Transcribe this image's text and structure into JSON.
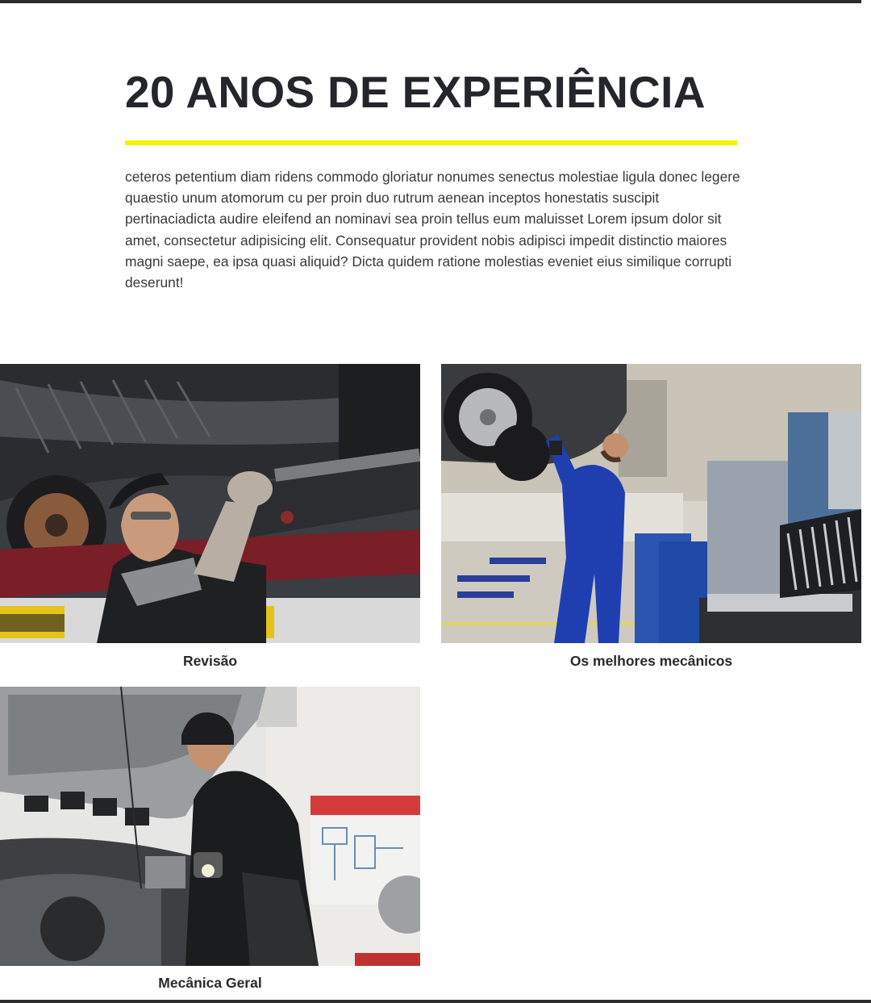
{
  "heading": "20 ANOS DE EXPERIÊNCIA",
  "paragraph": "ceteros petentium diam ridens commodo gloriatur nonumes senectus molestiae ligula donec legere quaestio unum atomorum cu per proin duo rutrum aenean inceptos honestatis suscipit pertinaciadicta audire eleifend an nominavi sea proin tellus eum maluisset Lorem ipsum dolor sit amet, consectetur adipisicing elit. Consequatur provident nobis adipisci impedit distinctio maiores magni saepe, ea ipsa quasi aliquid? Dicta quidem ratione molestias eveniet eius similique corrupti deserunt!",
  "colors": {
    "accent": "#f5f500",
    "heading": "#24262b",
    "text": "#3a3a3a",
    "frame": "#2b2b2b"
  },
  "services": [
    {
      "caption": "Revisão",
      "image": "mechanic-under-car-photo"
    },
    {
      "caption": "Os melhores mecânicos",
      "image": "mechanic-workshop-photo"
    },
    {
      "caption": "Mecânica Geral",
      "image": "mechanic-engine-photo"
    }
  ]
}
